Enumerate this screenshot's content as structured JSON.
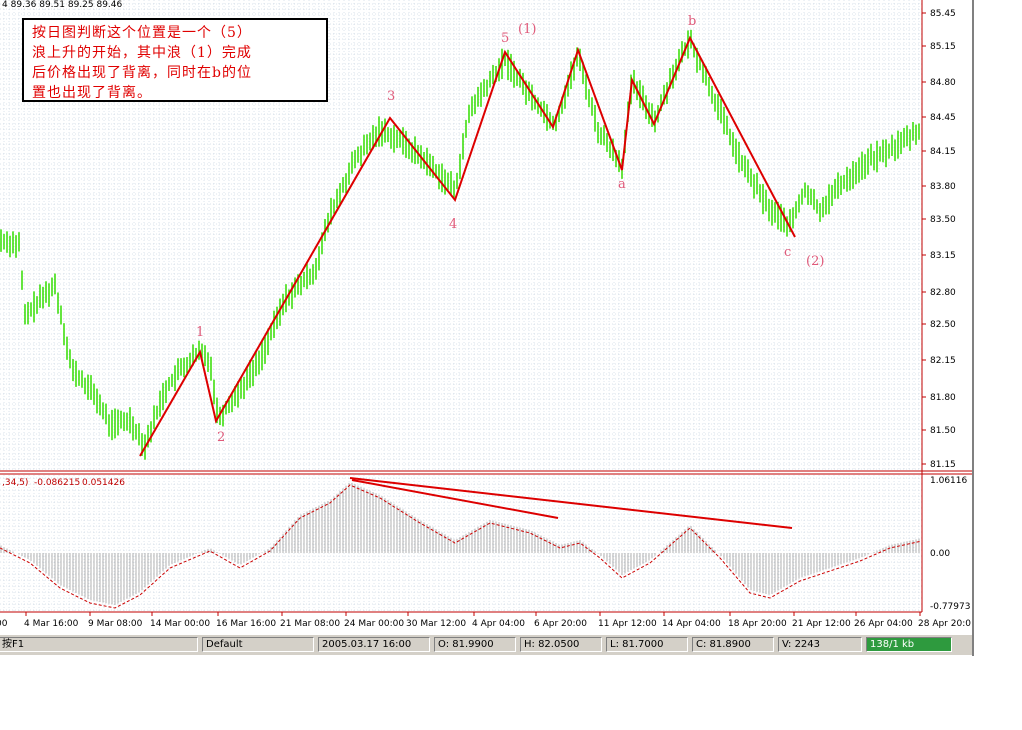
{
  "header": {
    "ohlc": "4  89.36 89.51 89.25 89.46"
  },
  "note": {
    "text": "按日图判断这个位置是一个（5）\n浪上升的开始，其中浪（1）完成\n后价格出现了背离，同时在b的位\n置也出现了背离。"
  },
  "indicator": {
    "params": ",34,5)",
    "v1": "-0.086215",
    "v2": "0.051426"
  },
  "price_axis": [
    "85.45",
    "85.15",
    "84.80",
    "84.45",
    "84.15",
    "83.80",
    "83.50",
    "83.15",
    "82.80",
    "82.50",
    "82.15",
    "81.80",
    "81.50",
    "81.15"
  ],
  "ind_axis": [
    "1.06116",
    "0.00",
    "-0.77973"
  ],
  "time_axis": [
    "00",
    "4 Mar 16:00",
    "9 Mar 08:00",
    "14 Mar 00:00",
    "16 Mar 16:00",
    "21 Mar 08:00",
    "24 Mar 00:00",
    "30 Mar 12:00",
    "4 Apr 04:00",
    "6 Apr 20:00",
    "11 Apr 12:00",
    "14 Apr 04:00",
    "18 Apr 20:00",
    "21 Apr 12:00",
    "26 Apr 04:00",
    "28 Apr 20:0"
  ],
  "wave_labels": [
    "1",
    "2",
    "3",
    "4",
    "5",
    "(1)",
    "a",
    "b",
    "c",
    "(2)"
  ],
  "status": {
    "help": "按F1",
    "profile": "Default",
    "datetime": "2005.03.17 16:00",
    "open": "O: 81.9900",
    "high": "H: 82.0500",
    "low": "L: 81.7000",
    "close": "C: 81.8900",
    "volume": "V: 2243",
    "traffic": "138/1 kb"
  },
  "colors": {
    "candle": "#33dd00",
    "wave_line": "#dd0000",
    "label": "#e05a7a",
    "grid": "#b8c8d8"
  }
}
